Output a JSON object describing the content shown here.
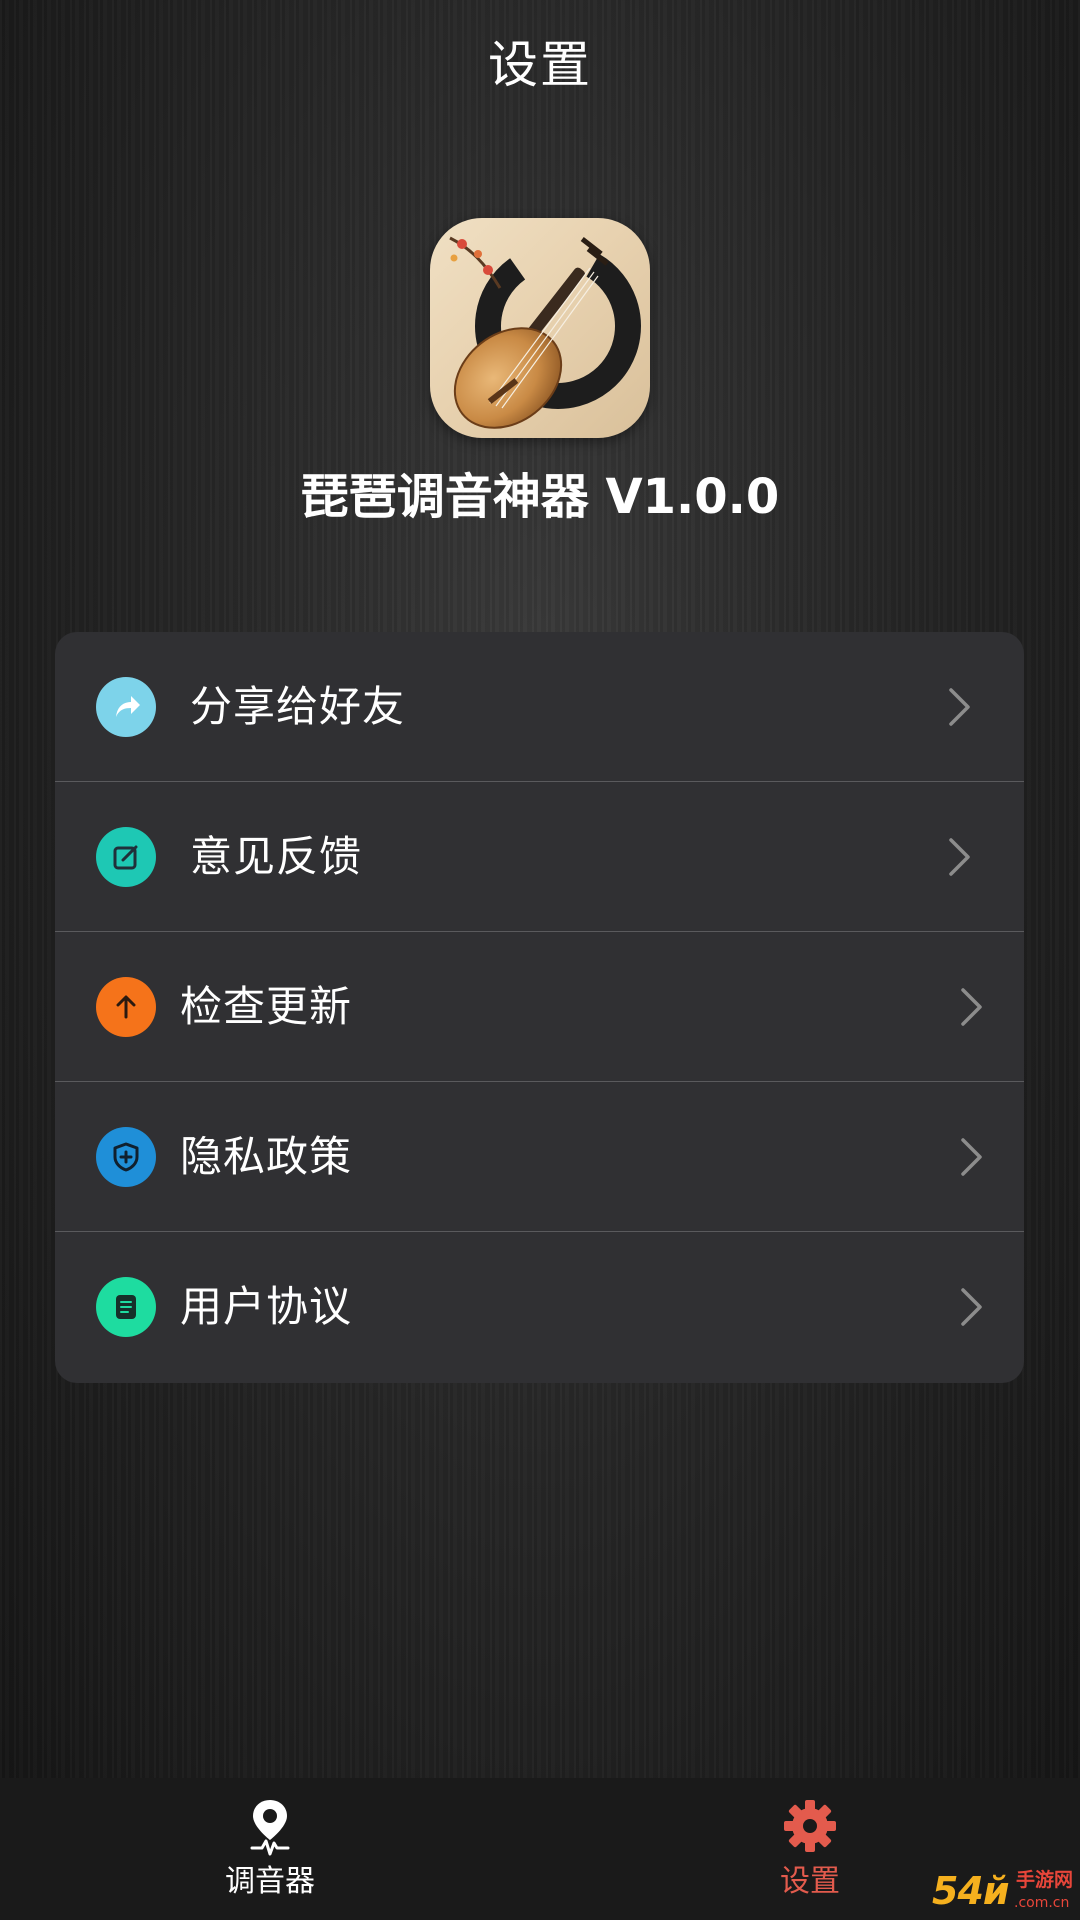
{
  "header": {
    "title": "设置"
  },
  "app": {
    "logo_icon": "pipa-lute-icon",
    "name": "琵琶调音神器 V1.0.0"
  },
  "menu": {
    "items": [
      {
        "label": "分享给好友",
        "icon": "share-icon",
        "icon_color": "#7dd3ea"
      },
      {
        "label": "意见反馈",
        "icon": "edit-icon",
        "icon_color": "#1ec8b4"
      },
      {
        "label": "检查更新",
        "icon": "arrow-up-icon",
        "icon_color": "#f5731a"
      },
      {
        "label": "隐私政策",
        "icon": "shield-icon",
        "icon_color": "#1f8fd8"
      },
      {
        "label": "用户协议",
        "icon": "document-icon",
        "icon_color": "#1edca0"
      }
    ]
  },
  "tabbar": {
    "tabs": [
      {
        "label": "调音器",
        "icon": "location-pulse-icon",
        "active": false
      },
      {
        "label": "设置",
        "icon": "gear-icon",
        "active": true
      }
    ],
    "active_color": "#e35b4d"
  },
  "watermark": {
    "digits": "54й",
    "name": "手游网",
    "domain": ".com.cn"
  }
}
